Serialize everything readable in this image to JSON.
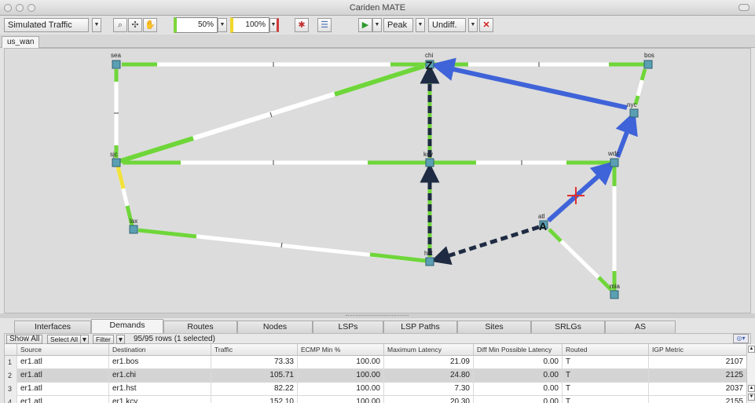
{
  "window": {
    "title": "Cariden MATE"
  },
  "toolbar": {
    "traffic_mode": "Simulated Traffic",
    "threshold_low": "50%",
    "threshold_high": "100%",
    "peak_label": "Peak",
    "diff_label": "Undiff."
  },
  "plot_tab": "us_wan",
  "map": {
    "colors": {
      "link_green": "#6fd63a",
      "link_yellow": "#f2e23a",
      "lsp_blue": "#3f63d8",
      "lsp_dark": "#1e2b42",
      "node": "#5b9fb3",
      "failure_cross": "#e03030"
    },
    "nodes": [
      {
        "name": "sea"
      },
      {
        "name": "chi"
      },
      {
        "name": "bos"
      },
      {
        "name": "nyc"
      },
      {
        "name": "sjc"
      },
      {
        "name": "kcy"
      },
      {
        "name": "wdc"
      },
      {
        "name": "lax"
      },
      {
        "name": "atl"
      },
      {
        "name": "hst"
      },
      {
        "name": "mia"
      }
    ],
    "endpoint_markers": {
      "z": "Z",
      "a": "A"
    }
  },
  "bottom_tabs": [
    "Interfaces",
    "Demands",
    "Routes",
    "Nodes",
    "LSPs",
    "LSP Paths",
    "Sites",
    "SRLGs",
    "AS"
  ],
  "filter": {
    "show_all": "Show All",
    "select_all": "Select All",
    "filter_label": "Filter",
    "row_count": "95/95 rows (1 selected)"
  },
  "table": {
    "columns": [
      "Source",
      "Destination",
      "Traffic",
      "ECMP Min %",
      "Maximum Latency",
      "Diff Min Possible Latency",
      "Routed",
      "IGP Metric"
    ],
    "rows": [
      {
        "idx": "1",
        "source": "er1.atl",
        "dest": "er1.bos",
        "traffic": "73.33",
        "ecmp": "100.00",
        "maxlat": "21.09",
        "diffmin": "0.00",
        "routed": "T",
        "igp": "2107"
      },
      {
        "idx": "2",
        "source": "er1.atl",
        "dest": "er1.chi",
        "traffic": "105.71",
        "ecmp": "100.00",
        "maxlat": "24.80",
        "diffmin": "0.00",
        "routed": "T",
        "igp": "2125"
      },
      {
        "idx": "3",
        "source": "er1.atl",
        "dest": "er1.hst",
        "traffic": "82.22",
        "ecmp": "100.00",
        "maxlat": "7.30",
        "diffmin": "0.00",
        "routed": "T",
        "igp": "2037"
      },
      {
        "idx": "4",
        "source": "er1.atl",
        "dest": "er1.kcy",
        "traffic": "152.10",
        "ecmp": "100.00",
        "maxlat": "20.30",
        "diffmin": "0.00",
        "routed": "T",
        "igp": "2155"
      }
    ]
  }
}
